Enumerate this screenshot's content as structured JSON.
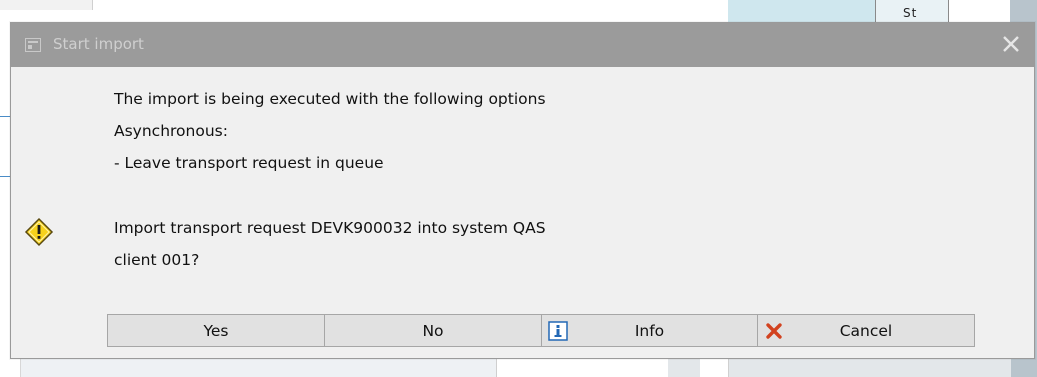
{
  "background": {
    "column_header_fragment": "St"
  },
  "dialog": {
    "title": "Start import",
    "title_icon": "window-icon",
    "close_icon": "close-icon",
    "message_lines": [
      "The import is being executed with the following options",
      "Asynchronous:",
      "- Leave transport request in queue",
      "Import transport request DEVK900032 into system QAS",
      "client 001?"
    ],
    "warning_icon": "warning-icon",
    "buttons": {
      "yes": "Yes",
      "no": "No",
      "info": "Info",
      "cancel": "Cancel"
    },
    "button_icons": {
      "info": "info-icon",
      "cancel": "cancel-x-icon"
    }
  },
  "colors": {
    "titlebar": "#9b9b9b",
    "dialog_bg": "#f0f0f0",
    "button_bg": "#e1e1e1",
    "warning_fill": "#f7d21b",
    "info_blue": "#2368b5",
    "cancel_red": "#d2421f"
  }
}
